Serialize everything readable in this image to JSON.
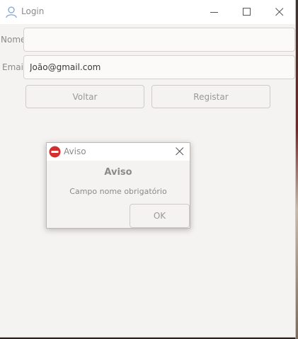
{
  "window": {
    "title": "Login",
    "icon": "user-icon"
  },
  "form": {
    "name_label": "Nome",
    "name_value": "",
    "email_label": "Email",
    "email_value": "João@gmail.com",
    "back_label": "Voltar",
    "register_label": "Registar"
  },
  "dialog": {
    "title": "Aviso",
    "icon": "error-icon",
    "heading": "Aviso",
    "message": "Campo nome obrigatório",
    "ok_label": "OK"
  },
  "colors": {
    "window_bg": "#f5f3f1",
    "titlebar_bg": "#ffffff",
    "error_red": "#d32f2f",
    "text_muted": "#8a8a8a"
  }
}
